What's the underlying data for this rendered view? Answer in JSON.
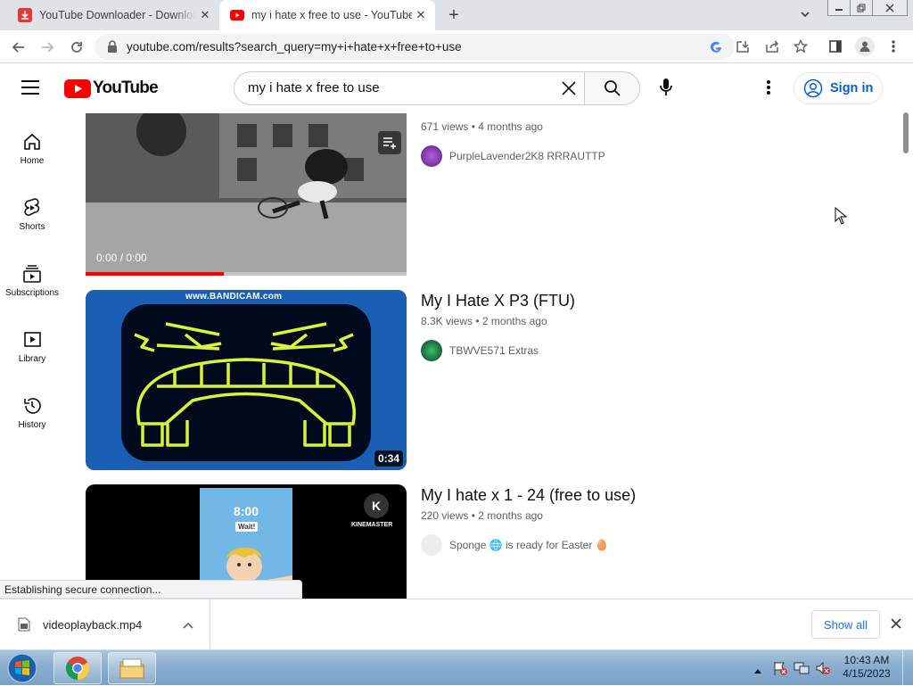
{
  "browser": {
    "tabs": [
      {
        "title": "YouTube Downloader - Download Video",
        "active": false
      },
      {
        "title": "my i hate x free to use - YouTube",
        "active": true
      }
    ],
    "new_tab_label": "+",
    "url": "youtube.com/results?search_query=my+i+hate+x+free+to+use",
    "status_text": "Establishing secure connection..."
  },
  "youtube": {
    "logo_text": "YouTube",
    "search_value": "my i hate x free to use",
    "sign_in_label": "Sign in",
    "guide": [
      {
        "label": "Home",
        "icon": "home-icon"
      },
      {
        "label": "Shorts",
        "icon": "shorts-icon"
      },
      {
        "label": "Subscriptions",
        "icon": "subscriptions-icon"
      },
      {
        "label": "Library",
        "icon": "library-icon"
      },
      {
        "label": "History",
        "icon": "history-icon"
      }
    ],
    "results": [
      {
        "title": "",
        "views": "671 views",
        "age": "4 months ago",
        "channel": "PurpleLavender2K8 RRRAUTTP",
        "player_time": "0:00 / 0:00",
        "progress": 0.43
      },
      {
        "title": "My I Hate X P3 (FTU)",
        "views": "8.3K views",
        "age": "2 months ago",
        "channel": "TBWVE571 Extras",
        "duration": "0:34",
        "watermark": "www.BANDICAM.com"
      },
      {
        "title": "My I hate x 1 - 24 (free to use)",
        "views": "220 views",
        "age": "2 months ago",
        "channel": "Sponge 🌐 is ready for Easter 🥚",
        "thumb_time": "8:00",
        "thumb_button": "Wait!",
        "thumb_brand": "KINEMASTER"
      }
    ],
    "meta_separator": "•"
  },
  "download_shelf": {
    "file_name": "videoplayback.mp4",
    "show_all_label": "Show all"
  },
  "taskbar": {
    "time": "10:43 AM",
    "date": "4/15/2023"
  },
  "colors": {
    "youtube_red": "#ff0000",
    "link_blue": "#065fd4",
    "chrome_tabstrip": "#dfe3e8",
    "thumb2_bg": "#1a5fb4",
    "thumb2_stroke": "#d9f23a"
  }
}
